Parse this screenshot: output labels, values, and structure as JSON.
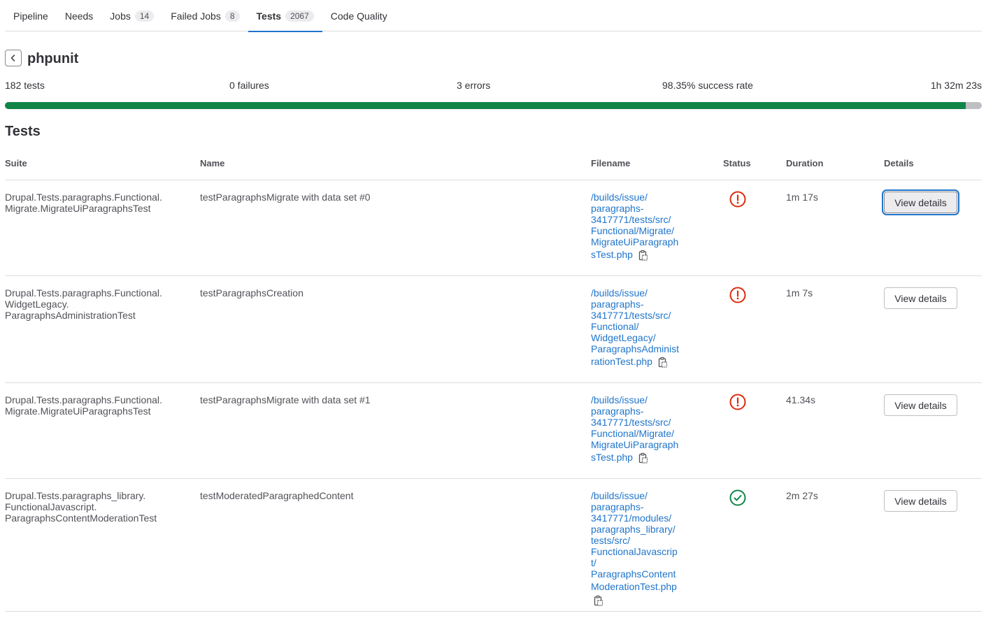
{
  "tabs": [
    {
      "label": "Pipeline"
    },
    {
      "label": "Needs"
    },
    {
      "label": "Jobs",
      "count": "14"
    },
    {
      "label": "Failed Jobs",
      "count": "8"
    },
    {
      "label": "Tests",
      "count": "2067",
      "active": true
    },
    {
      "label": "Code Quality"
    }
  ],
  "suite": {
    "title": "phpunit",
    "tests": "182 tests",
    "failures": "0 failures",
    "errors": "3 errors",
    "success_rate": "98.35% success rate",
    "duration": "1h 32m 23s",
    "success_fraction": 0.9835
  },
  "section_title": "Tests",
  "columns": {
    "suite": "Suite",
    "name": "Name",
    "filename": "Filename",
    "status": "Status",
    "duration": "Duration",
    "details": "Details"
  },
  "rows": [
    {
      "suite": [
        "Drupal.Tests.paragraphs.Functional.",
        "Migrate.MigrateUiParagraphsTest"
      ],
      "name": "testParagraphsMigrate with data set #0",
      "filename": [
        "/builds/issue/",
        "paragraphs-",
        "3417771/tests/src/",
        "Functional/Migrate/",
        "MigrateUiParagraph",
        "sTest.php"
      ],
      "status": "error",
      "duration": "1m 17s",
      "details_label": "View details"
    },
    {
      "suite": [
        "Drupal.Tests.paragraphs.Functional.",
        "WidgetLegacy.",
        "ParagraphsAdministrationTest"
      ],
      "name": "testParagraphsCreation",
      "filename": [
        "/builds/issue/",
        "paragraphs-",
        "3417771/tests/src/",
        "Functional/",
        "WidgetLegacy/",
        "ParagraphsAdminist",
        "rationTest.php"
      ],
      "status": "error",
      "duration": "1m 7s",
      "details_label": "View details"
    },
    {
      "suite": [
        "Drupal.Tests.paragraphs.Functional.",
        "Migrate.MigrateUiParagraphsTest"
      ],
      "name": "testParagraphsMigrate with data set #1",
      "filename": [
        "/builds/issue/",
        "paragraphs-",
        "3417771/tests/src/",
        "Functional/Migrate/",
        "MigrateUiParagraph",
        "sTest.php"
      ],
      "status": "error",
      "duration": "41.34s",
      "details_label": "View details"
    },
    {
      "suite": [
        "Drupal.Tests.paragraphs_library.",
        "FunctionalJavascript.",
        "ParagraphsContentModerationTest"
      ],
      "name": "testModeratedParagraphedContent",
      "filename": [
        "/builds/issue/",
        "paragraphs-",
        "3417771/modules/",
        "paragraphs_library/",
        "tests/src/",
        "FunctionalJavascrip",
        "t/",
        "ParagraphsContent",
        "ModerationTest.php"
      ],
      "status": "success",
      "duration": "2m 27s",
      "details_label": "View details"
    }
  ],
  "colors": {
    "accent": "#1f75cb",
    "success": "#108548",
    "error": "#dd2b0e"
  }
}
